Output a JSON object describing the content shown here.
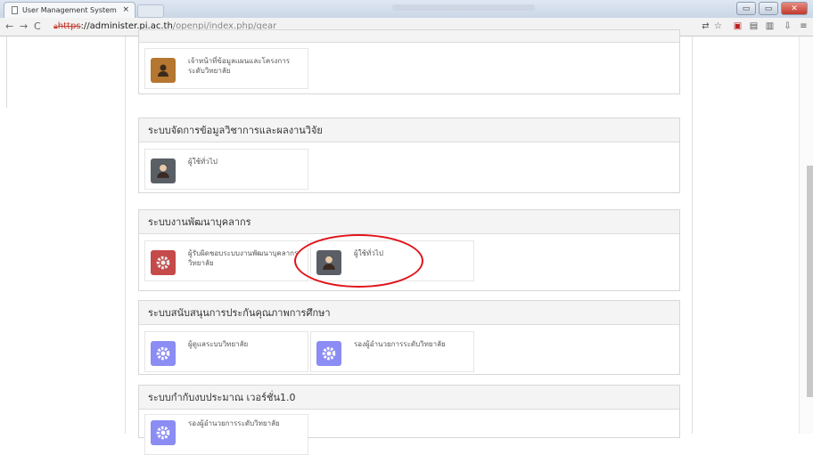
{
  "browser": {
    "tab_title": "User Management System",
    "tab_close": "×",
    "url_https": "https",
    "url_host": "://administer.pi.ac.th",
    "url_path": "/openpi/index.php/gear"
  },
  "sections": [
    {
      "title": "",
      "cards": [
        {
          "label": "เจ้าหน้าที่ข้อมูลแผนและโครงการ ระดับวิทยาลัย",
          "icon": "person-icon",
          "color": "#b5762f"
        }
      ]
    },
    {
      "title": "ระบบจัดการข้อมูลวิชาการและผลงานวิจัย",
      "cards": [
        {
          "label": "ผู้ใช้ทั่วไป",
          "icon": "person-icon",
          "color": "#5a5f66"
        }
      ]
    },
    {
      "title": "ระบบงานพัฒนาบุคลากร",
      "cards": [
        {
          "label": "ผู้รับผิดชอบระบบงานพัฒนาบุคลากรวิทยาลัย",
          "icon": "gear-icon",
          "color": "#c54a4a"
        },
        {
          "label": "ผู้ใช้ทั่วไป",
          "icon": "person-icon",
          "color": "#5a5f66"
        }
      ]
    },
    {
      "title": "ระบบสนับสนุนการประกันคุณภาพการศึกษา",
      "cards": [
        {
          "label": "ผู้ดูแลระบบวิทยาลัย",
          "icon": "gear-icon",
          "color": "#8b8cf4"
        },
        {
          "label": "รองผู้อำนวยการระดับวิทยาลัย",
          "icon": "gear-icon",
          "color": "#8b8cf4"
        }
      ]
    },
    {
      "title": "ระบบกำกับงบประมาณ เวอร์ชั่น1.0",
      "cards": [
        {
          "label": "รองผู้อำนวยการระดับวิทยาลัย",
          "icon": "gear-icon",
          "color": "#8b8cf4"
        }
      ]
    }
  ]
}
